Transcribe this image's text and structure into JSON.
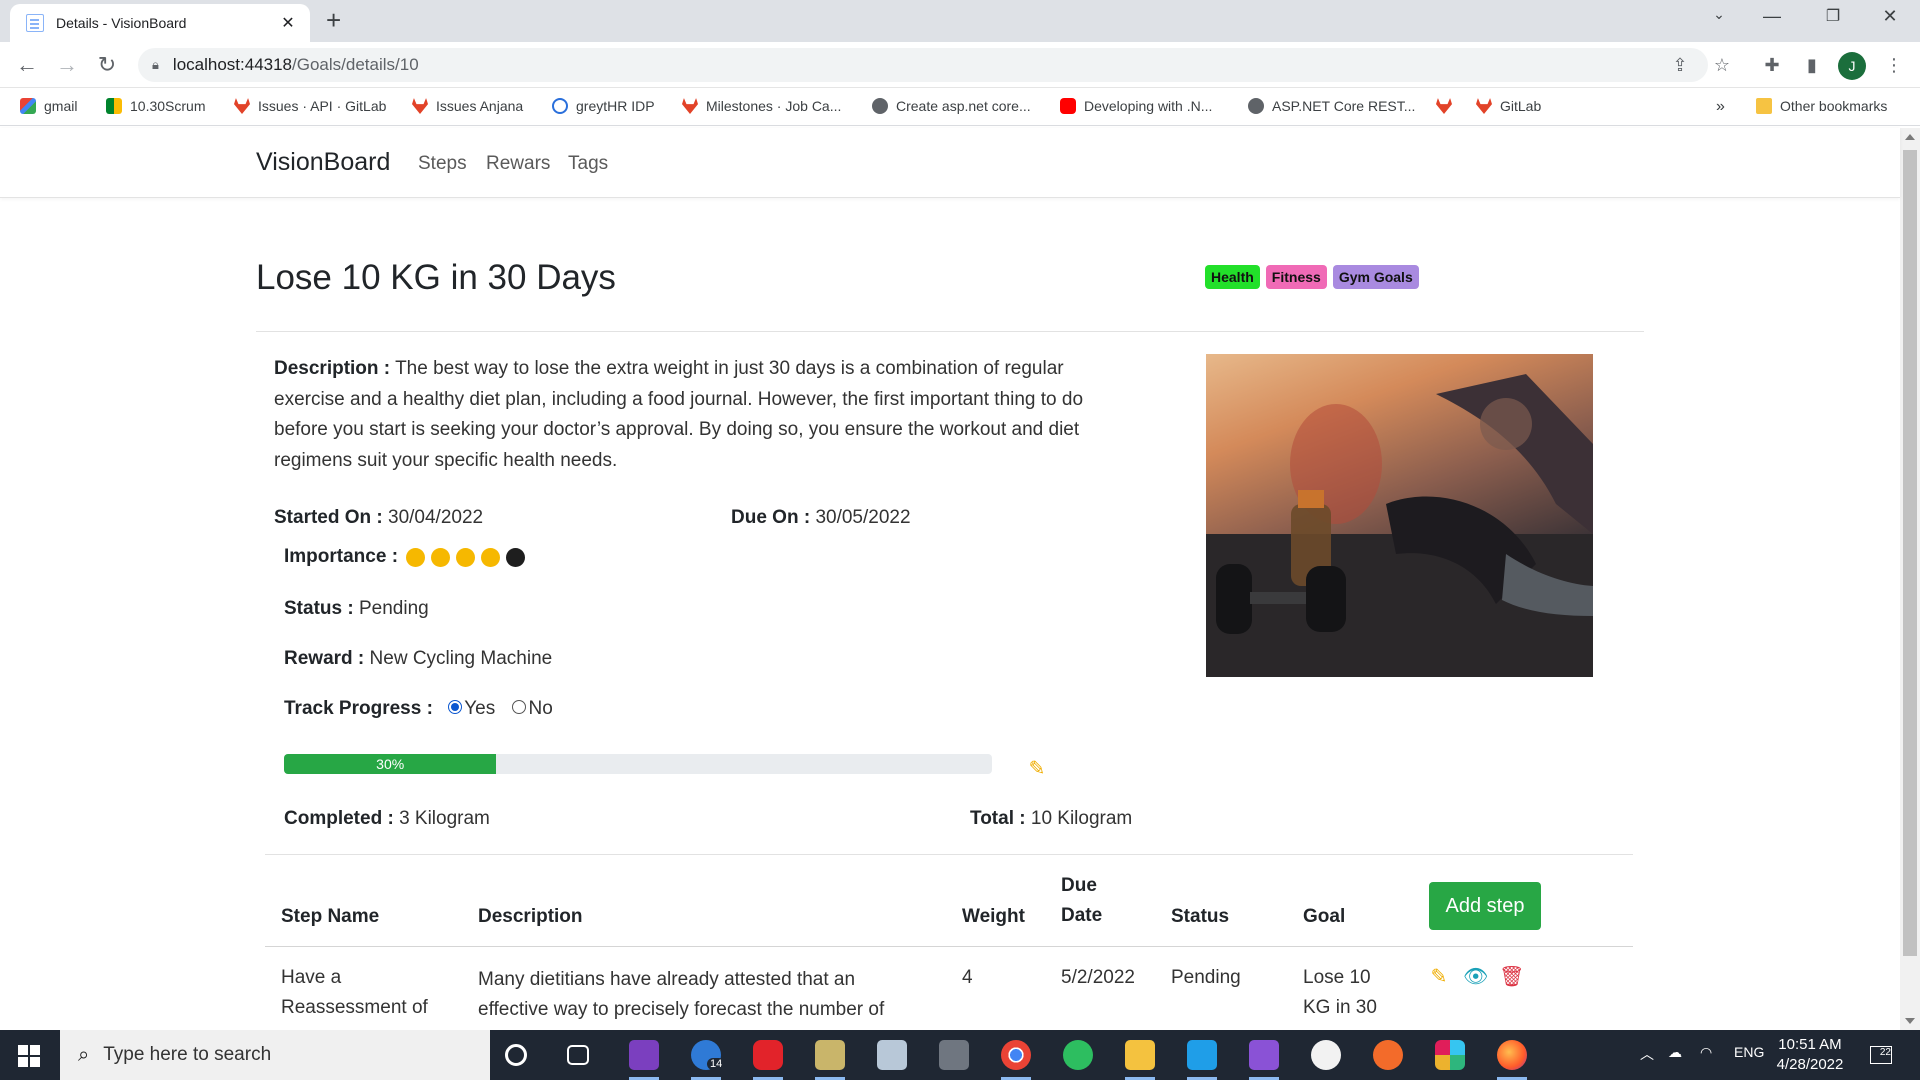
{
  "browser": {
    "tab_title": "Details - VisionBoard",
    "tab_close": "✕",
    "new_tab": "+",
    "url_host": "localhost:44318",
    "url_path": "/Goals/details/10",
    "profile_initial": "J",
    "bookmarks": [
      {
        "label": "gmail",
        "icon": "gmail-icon"
      },
      {
        "label": "10.30Scrum",
        "icon": "meet-icon"
      },
      {
        "label": "Issues · API · GitLab",
        "icon": "gitlab-icon"
      },
      {
        "label": "Issues Anjana",
        "icon": "gitlab-icon"
      },
      {
        "label": "greytHR IDP",
        "icon": "greythr-icon"
      },
      {
        "label": "Milestones · Job Ca...",
        "icon": "gitlab-icon"
      },
      {
        "label": "Create asp.net core...",
        "icon": "globe-icon"
      },
      {
        "label": "Developing with .N...",
        "icon": "youtube-icon"
      },
      {
        "label": "ASP.NET Core REST...",
        "icon": "globe-icon"
      },
      {
        "label": "",
        "icon": "gitlab-icon"
      },
      {
        "label": "GitLab",
        "icon": "gitlab-icon"
      }
    ],
    "bookmarks_overflow": "»",
    "other_bookmarks": "Other bookmarks"
  },
  "app": {
    "brand": "VisionBoard",
    "nav": [
      "Steps",
      "Rewars",
      "Tags"
    ]
  },
  "goal": {
    "title": "Lose 10 KG in 30 Days",
    "tags": [
      {
        "label": "Health",
        "color": "#22e02a"
      },
      {
        "label": "Fitness",
        "color": "#f06ab6"
      },
      {
        "label": "Gym Goals",
        "color": "#a98ae0"
      }
    ],
    "description_label": "Description :",
    "description": "The best way to lose the extra weight in just 30 days is a combination of regular exercise and a healthy diet plan, including a food journal. However, the first important thing to do before you start is seeking your doctor’s approval. By doing so, you ensure the workout and diet regimens suit your specific health needs.",
    "started_label": "Started On :",
    "started": "30/04/2022",
    "due_label": "Due On :",
    "due": "30/05/2022",
    "importance_label": "Importance :",
    "importance": 4,
    "importance_max": 5,
    "importance_on_color": "#f6b800",
    "importance_off_color": "#1e1e1e",
    "status_label": "Status :",
    "status": "Pending",
    "reward_label": "Reward :",
    "reward": "New Cycling Machine",
    "track_label": "Track Progress :",
    "track_yes": "Yes",
    "track_no": "No",
    "track_selected": "Yes",
    "progress_percent": 30,
    "progress_text": "30%",
    "completed_label": "Completed :",
    "completed": "3 Kilogram",
    "total_label": "Total :",
    "total": "10 Kilogram"
  },
  "steps_table": {
    "headers": {
      "step_name": "Step Name",
      "description": "Description",
      "weight": "Weight",
      "due_date": "Due Date",
      "status": "Status",
      "goal": "Goal"
    },
    "add_step_label": "Add step",
    "rows": [
      {
        "step_name": "Have a Reassessment of",
        "description": "Many dietitians have already attested that an effective way to precisely forecast the number of",
        "weight": "4",
        "due_date": "5/2/2022",
        "status": "Pending",
        "goal": "Lose 10 KG in 30"
      }
    ]
  },
  "taskbar": {
    "search_placeholder": "Type here to search",
    "language": "ENG",
    "time": "10:51 AM",
    "date": "4/28/2022",
    "todo_badge": "14",
    "notification_count": "22"
  }
}
